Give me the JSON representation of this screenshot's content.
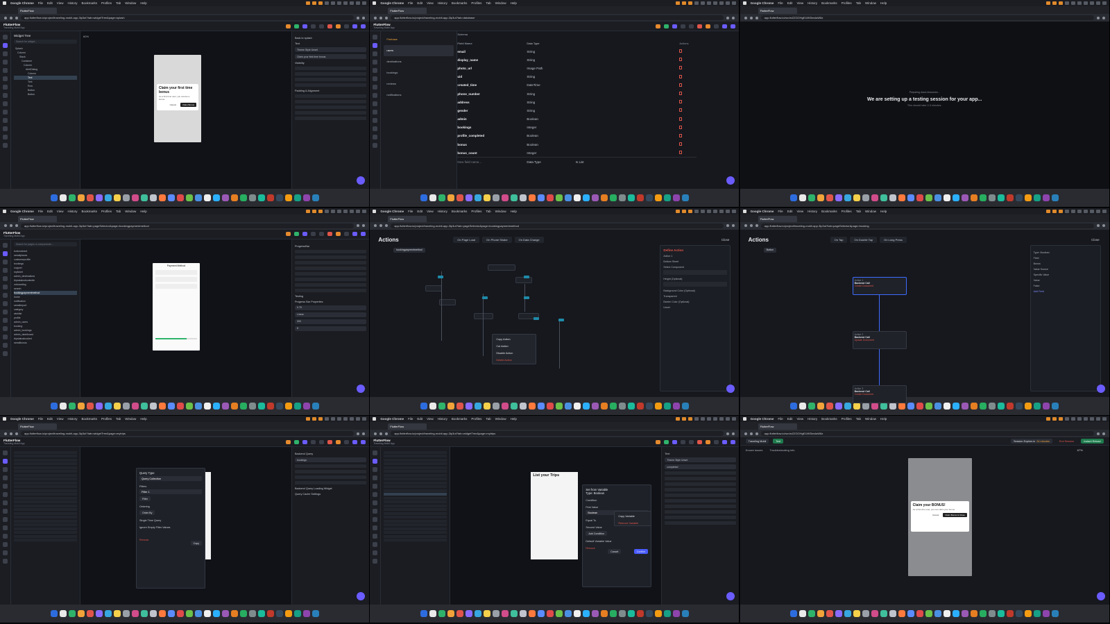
{
  "menubar": {
    "app": "Google Chrome",
    "items": [
      "File",
      "Edit",
      "View",
      "History",
      "Bookmarks",
      "Profiles",
      "Tab",
      "Window",
      "Help"
    ]
  },
  "flutterflow": {
    "brand": "FlutterFlow",
    "project": "Traveling Mobil App"
  },
  "panels": {
    "p1": {
      "tab": "FlutterFlow",
      "url": "app.flutterflow.io/project/traveling-mobil-app-3lp3ut?tab=widgetTree&page=splash",
      "tree_title": "Widget Tree",
      "tree_search": "Search for widget...",
      "tree_rows": [
        "Splash",
        "Column",
        "Stack",
        "Container",
        "Column",
        "AlertDialog",
        "Column",
        "Text",
        "Text",
        "Row",
        "Button",
        "Button"
      ],
      "zoom": "60%",
      "dialog_title": "Claim your first time bonus",
      "dialog_text": "As a first time user, you receive a bonus.",
      "dialog_cancel": "Cancel",
      "dialog_ok": "Claim Bonus",
      "props_back": "Back to splash",
      "props_title": "Text",
      "props_style": "Theme Style Unset",
      "props_text": "Claim your first time bonus",
      "props_visibility": "Visibility",
      "props_padding": "Padding & Alignment"
    },
    "p2": {
      "tab": "FlutterFlow",
      "url": "app.flutterflow.io/project/traveling-mobil-app-3lp3ut?tab=database",
      "firebase": "Firebase",
      "collections": [
        "users",
        "destinations",
        "bookings",
        "reviews",
        "notifications"
      ],
      "schema_label": "Schema",
      "col_name": "Field Name",
      "col_type": "Data Type",
      "col_actions": "Actions",
      "fields": [
        {
          "name": "email",
          "type": "String"
        },
        {
          "name": "display_name",
          "type": "String"
        },
        {
          "name": "photo_url",
          "type": "Image Path"
        },
        {
          "name": "uid",
          "type": "String"
        },
        {
          "name": "created_time",
          "type": "DateTime"
        },
        {
          "name": "phone_number",
          "type": "String"
        },
        {
          "name": "address",
          "type": "String"
        },
        {
          "name": "gender",
          "type": "String"
        },
        {
          "name": "admin",
          "type": "Boolean"
        },
        {
          "name": "bookings",
          "type": "Integer"
        },
        {
          "name": "profile_completed",
          "type": "Boolean"
        },
        {
          "name": "bonus",
          "type": "Boolean"
        },
        {
          "name": "bonus_count",
          "type": "Integer"
        }
      ],
      "new_field": "New field name...",
      "new_type": "Data Type",
      "is_list": "Is List"
    },
    "p3": {
      "tab": "FlutterFlow",
      "url": "app.flutterflow.io/run/sr2ZGOHgEUW3bn4aW8z",
      "pre": "Preparing cloud resources...",
      "title": "We are setting up a testing session for your app...",
      "sub": "This should take 2-3 minutes."
    },
    "p4": {
      "tab": "FlutterFlow",
      "url": "app.flutterflow.io/project/traveling-mobil-app-3lp3ut?tab=pageSelector&page=bookingpaymentmethod",
      "tree_search": "Search for pages or components...",
      "pages": [
        "bottomsheet",
        "seeallplaces",
        "customerprofile",
        "bookings",
        "support",
        "myticket",
        "admin_destinations",
        "tripsstatusbookedin",
        "onboarding",
        "search",
        "bookingpaymentmethod",
        "home",
        "notification",
        "seeallreport",
        "category",
        "wishlist",
        "profile",
        "admin_users",
        "booking",
        "admin_bookings",
        "admin_dashboard",
        "tripstatusbooked",
        "seeallbonus"
      ],
      "phone_title": "Payment Method",
      "props_title": "ProgressBar",
      "section": "Testing",
      "progress_label": "Progress Bar Properties",
      "progress_value": "0.75",
      "shape": "Linear",
      "width": "300",
      "thickness": "8"
    },
    "p5": {
      "tab": "FlutterFlow",
      "url": "app.flutterflow.io/project/traveling-mobil-app-3lp3ut?tab=pageSelector&page=bookingpaymentmethod",
      "title": "Actions",
      "tabs": [
        "On Page Load",
        "On Phone Shake",
        "On Data Change"
      ],
      "close": "Close",
      "crumb": "bookingpaymentmethod",
      "menu": [
        "Copy Action",
        "Cut Action",
        "Disable Action",
        "Delete Action"
      ],
      "panel_title": "Define Action",
      "panel_action": "Action 1",
      "panel_type": "Bottom Sheet",
      "panel_component": "Select Component",
      "panel_height": "Height (Optional)",
      "panel_bg": "Background Color (Optional)",
      "panel_bg_val": "Transparent",
      "panel_barrier": "Barrier Color (Optional)",
      "panel_barrier_val": "Unset"
    },
    "p6": {
      "tab": "FlutterFlow",
      "url": "app.flutterflow.io/project/traveling-mobil-app-3lp3ut?tab=pageSelector&page=booking",
      "title": "Actions",
      "tabs": [
        "On Tap",
        "On Double Tap",
        "On Long Press"
      ],
      "close": "Close",
      "crumb": "Button",
      "nodes": [
        {
          "a": "Action 1",
          "b": "Backend Call",
          "c": "Create Document"
        },
        {
          "a": "Action 2",
          "b": "Backend Call",
          "c": "Update Document"
        },
        {
          "a": "Action 3",
          "b": "Backend Call",
          "c": "Create Document"
        }
      ],
      "panel_title": "Boolean",
      "panel_field": "Type: Boolean",
      "panel_field_lbl": "Field",
      "panel_field_val": "Bonus",
      "panel_source": "Value Source",
      "panel_source_val": "Specific Value",
      "panel_value": "Value",
      "panel_value_val": "False",
      "panel_add": "Add Field"
    },
    "p7": {
      "tab": "FlutterFlow",
      "url": "app.flutterflow.io/project/traveling-mobil-app-3lp3ut?tab=widgetTree&page=mytrips",
      "list_title": "List your Trips",
      "query_type": "Query Type",
      "query_val": "Query Collection",
      "filters": "Filters",
      "filter1": "Filter 1",
      "filter_btn": "Filter",
      "ordering": "Ordering",
      "order_btn": "Order By",
      "single_time": "Single Time Query",
      "ignore_empty": "Ignore Empty Filter Values",
      "remove": "Remove",
      "copy": "Copy",
      "collection": "bookings",
      "props_title": "Backend Query",
      "loading_widget": "Backend Query Loading Widget",
      "query_cache": "Query Cache Settings"
    },
    "p8": {
      "tab": "FlutterFlow",
      "url": "app.flutterflow.io/project/traveling-mobil-app-3lp3ut?tab=widgetTree&page=mytrips",
      "list_title": "List your Trips",
      "set_var": "Set from Variable",
      "type": "Type: Boolean",
      "condition": "Condition",
      "first_value": "First Value",
      "first_val": "Boolean",
      "equal_to": "Equal To",
      "second_value": "Second Value",
      "add_condition": "Add Condition",
      "default_var": "Default Variable Value",
      "remove": "Remove",
      "cancel": "Cancel",
      "confirm": "Confirm",
      "copy_var": "Copy Variable",
      "remove_var": "Remove Variable",
      "props_title": "Text",
      "props_style": "Theme Style Unset",
      "props_text": "completed"
    },
    "p9": {
      "tab": "FlutterFlow",
      "url": "app.flutterflow.io/run/sr2ZGOHgEUW3bn4aW8z",
      "project": "Traveling Mobil",
      "test_chip": "Test",
      "known": "Known issues",
      "trouble": "Troubleshooting info",
      "expires": "Session Expires in",
      "minutes": "24 minutes",
      "end": "End Session",
      "reload": "Instant Reload",
      "zoom": "67%",
      "dialog_title": "Claim your BONUS!",
      "dialog_text": "As a first time user, you can claim your bonus.",
      "dialog_cancel": "Cancel",
      "dialog_ok": "Claim Bonus & Close"
    }
  }
}
